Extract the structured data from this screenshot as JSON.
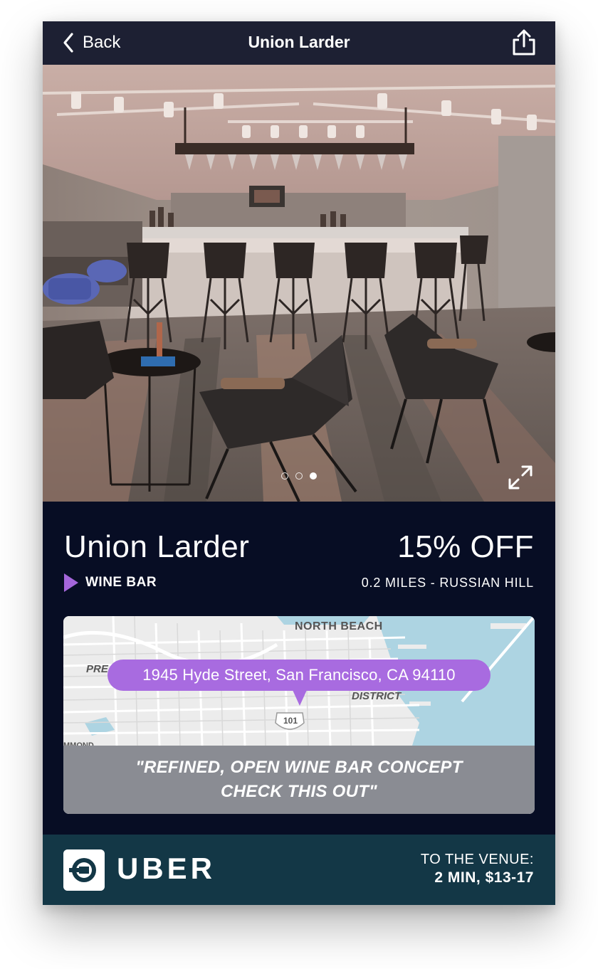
{
  "nav": {
    "back_label": "Back",
    "title": "Union Larder"
  },
  "gallery": {
    "page_count": 3,
    "active_page": 3
  },
  "venue": {
    "name": "Union Larder",
    "discount": "15% OFF",
    "category": "WINE BAR",
    "distance": "0.2 MILES - RUSSIAN HILL"
  },
  "map": {
    "address": "1945 Hyde Street, San Francisco, CA 94110",
    "labels": {
      "north_beach": "NORTH BEACH",
      "district": "DISTRICT",
      "pre": "PRE",
      "highway": "101",
      "cutoff": "MMOND"
    },
    "quote_line1": "\"REFINED, OPEN WINE BAR CONCEPT",
    "quote_line2": "CHECK THIS OUT\""
  },
  "uber": {
    "brand": "UBER",
    "eta_label": "TO THE VENUE:",
    "eta_value": "2 MIN, $13-17"
  },
  "colors": {
    "nav_bg": "#1d2033",
    "body_bg": "#070d24",
    "accent_purple": "#a86be0",
    "uber_bg": "#133746",
    "map_water": "#add4e2"
  }
}
